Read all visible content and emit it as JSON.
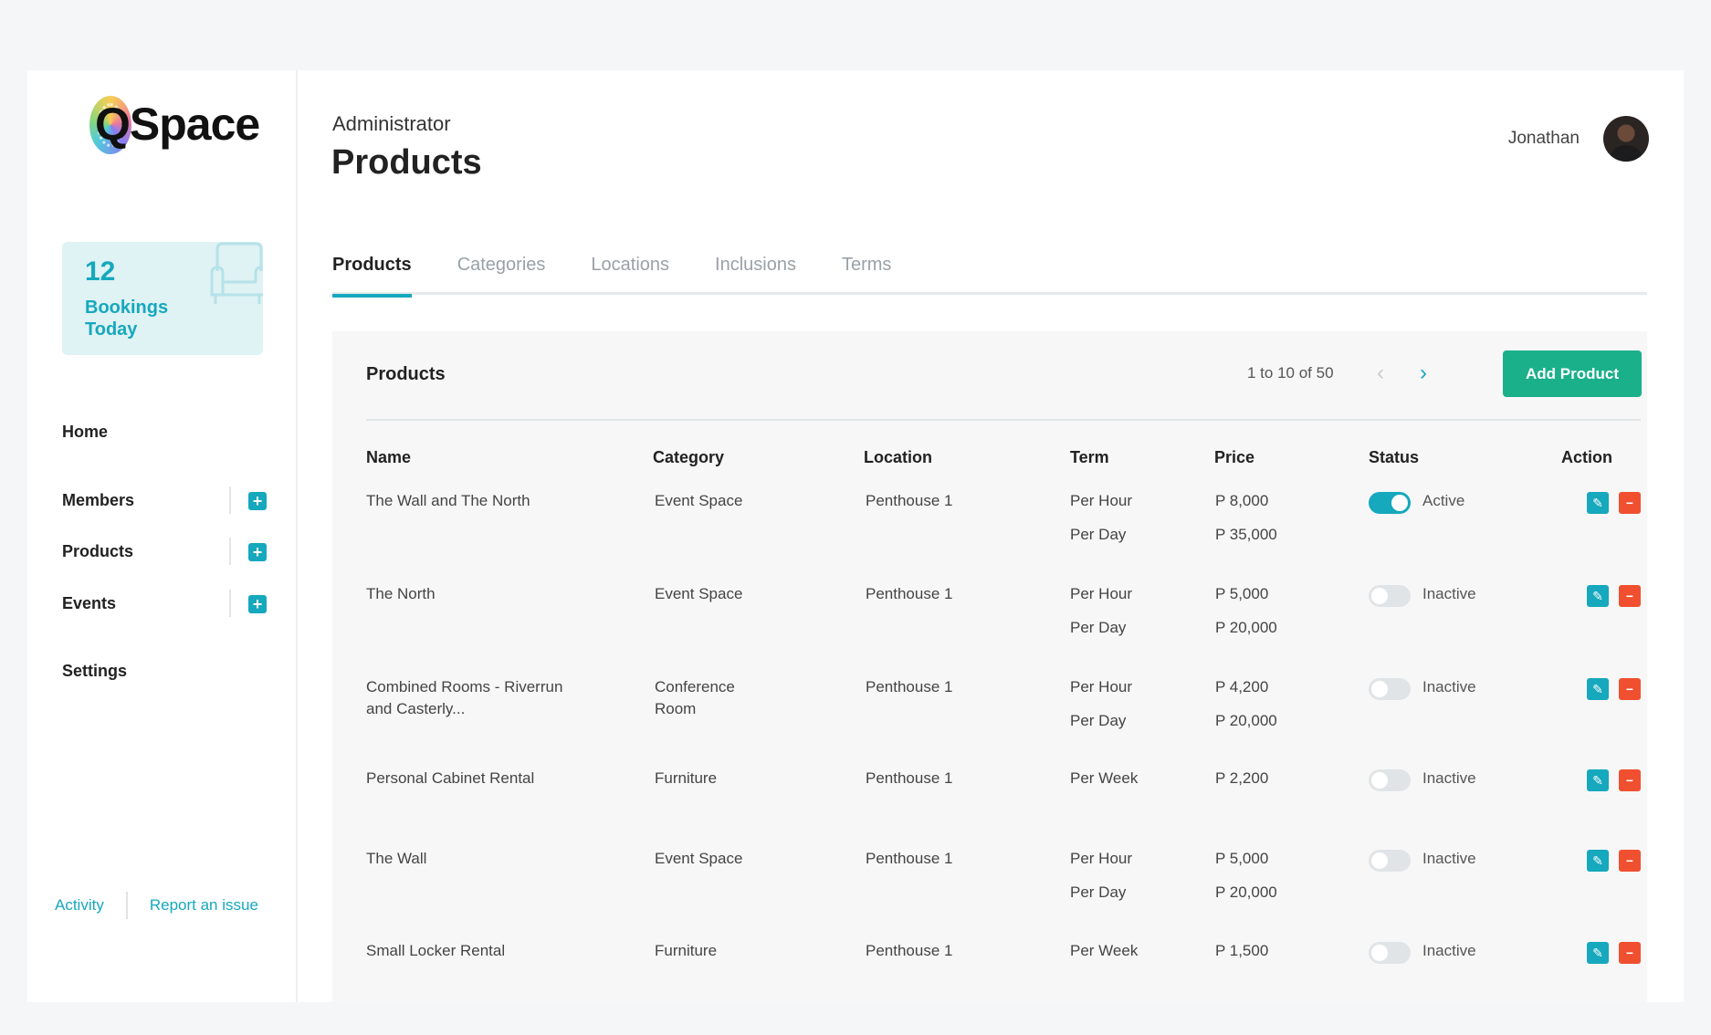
{
  "app": {
    "logo_text": "QSpace"
  },
  "sidebar": {
    "bookings": {
      "count": "12",
      "label": "Bookings Today"
    },
    "nav": [
      {
        "label": "Home"
      },
      {
        "label": "Members"
      },
      {
        "label": "Products"
      },
      {
        "label": "Events"
      },
      {
        "label": "Settings"
      }
    ],
    "footer": {
      "activity": "Activity",
      "report": "Report an issue"
    }
  },
  "header": {
    "role": "Administrator",
    "title": "Products",
    "user": "Jonathan"
  },
  "tabs": [
    "Products",
    "Categories",
    "Locations",
    "Inclusions",
    "Terms"
  ],
  "panel": {
    "title": "Products",
    "pagination": "1 to 10 of 50",
    "add_label": "Add Product",
    "columns": [
      "Name",
      "Category",
      "Location",
      "Term",
      "Price",
      "Status",
      "Action"
    ]
  },
  "rows": [
    {
      "name": "The Wall and The North",
      "category": "Event Space",
      "location": "Penthouse 1",
      "term1": "Per Hour",
      "price1": "P 8,000",
      "term2": "Per Day",
      "price2": "P 35,000",
      "status": "Active"
    },
    {
      "name": "The North",
      "category": "Event Space",
      "location": "Penthouse 1",
      "term1": "Per Hour",
      "price1": "P 5,000",
      "term2": "Per Day",
      "price2": "P 20,000",
      "status": "Inactive"
    },
    {
      "name": "Combined Rooms - Riverrun and Casterly...",
      "category": "Conference Room",
      "location": "Penthouse 1",
      "term1": "Per Hour",
      "price1": "P 4,200",
      "term2": "Per Day",
      "price2": "P 20,000",
      "status": "Inactive"
    },
    {
      "name": "Personal Cabinet Rental",
      "category": "Furniture",
      "location": "Penthouse 1",
      "term1": "Per Week",
      "price1": "P 2,200",
      "term2": "",
      "price2": "",
      "status": "Inactive"
    },
    {
      "name": "The Wall",
      "category": "Event Space",
      "location": "Penthouse 1",
      "term1": "Per Hour",
      "price1": "P 5,000",
      "term2": "Per Day",
      "price2": "P 20,000",
      "status": "Inactive"
    },
    {
      "name": "Small Locker Rental",
      "category": "Furniture",
      "location": "Penthouse 1",
      "term1": "Per Week",
      "price1": "P 1,500",
      "term2": "",
      "price2": "",
      "status": "Inactive"
    }
  ],
  "colors": {
    "accent": "#16a8bd",
    "add_button": "#1ab08a",
    "delete": "#f0502f"
  }
}
